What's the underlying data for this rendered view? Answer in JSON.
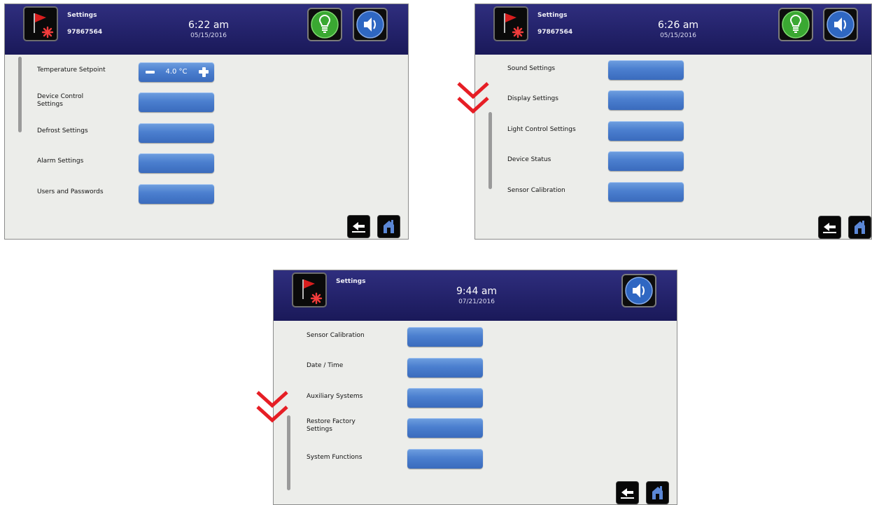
{
  "accent_colors": {
    "header": "#23226a",
    "button": "#4b7fcf",
    "chevron": "#e61e25",
    "bulb": "#3aa832"
  },
  "screens": [
    {
      "title": "Settings",
      "device_id": "97867564",
      "time": "6:22 am",
      "date": "05/15/2016",
      "header_icons": [
        "light-bulb-icon",
        "speaker-icon"
      ],
      "rows": [
        {
          "label": "Temperature Setpoint",
          "control": "stepper",
          "value": "4.0 °C"
        },
        {
          "label": "Device Control Settings",
          "control": "button"
        },
        {
          "label": "Defrost Settings",
          "control": "button"
        },
        {
          "label": "Alarm Settings",
          "control": "button"
        },
        {
          "label": "Users and Passwords",
          "control": "button"
        }
      ],
      "footer_icons": [
        "back-icon",
        "home-icon"
      ]
    },
    {
      "title": "Settings",
      "device_id": "97867564",
      "time": "6:26 am",
      "date": "05/15/2016",
      "header_icons": [
        "light-bulb-icon",
        "speaker-icon"
      ],
      "rows": [
        {
          "label": "Sound Settings",
          "control": "button"
        },
        {
          "label": "Display Settings",
          "control": "button"
        },
        {
          "label": "Light Control Settings",
          "control": "button"
        },
        {
          "label": "Device Status",
          "control": "button"
        },
        {
          "label": "Sensor Calibration",
          "control": "button"
        }
      ],
      "footer_icons": [
        "back-icon",
        "home-icon"
      ]
    },
    {
      "title": "Settings",
      "time": "9:44 am",
      "date": "07/21/2016",
      "header_icons": [
        "speaker-icon"
      ],
      "rows": [
        {
          "label": "Sensor Calibration",
          "control": "button"
        },
        {
          "label": "Date / Time",
          "control": "button"
        },
        {
          "label": "Auxiliary Systems",
          "control": "button"
        },
        {
          "label": "Restore Factory Settings",
          "control": "button"
        },
        {
          "label": "System Functions",
          "control": "button"
        }
      ],
      "footer_icons": [
        "back-icon",
        "home-icon"
      ]
    }
  ],
  "scroll_indicator_icon": "double-chevron-down-icon"
}
